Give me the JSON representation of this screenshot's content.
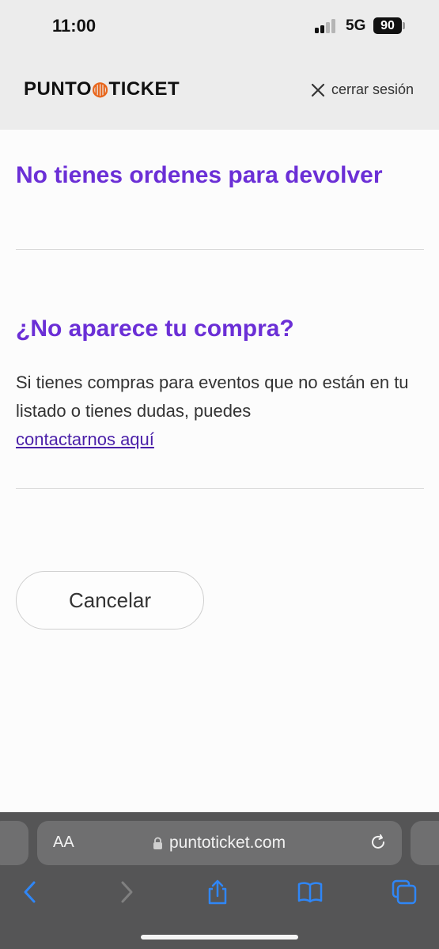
{
  "status_bar": {
    "time": "11:00",
    "network": "5G",
    "battery": "90"
  },
  "header": {
    "logo_text_left": "PUNTO",
    "logo_text_right": "TICKET",
    "logout_label": "cerrar sesión",
    "logo_icon": "flame-icon",
    "logout_icon": "close-icon"
  },
  "main": {
    "no_orders_title": "No tienes ordenes para devolver",
    "missing_title": "¿No aparece tu compra?",
    "missing_text": "Si tienes compras para eventos que no están en tu listado o tienes dudas, puedes",
    "contact_link": "contactarnos aquí",
    "cancel_button": "Cancelar"
  },
  "browser": {
    "text_size_label": "AA",
    "url": "puntoticket.com",
    "icons": [
      "lock-icon",
      "reload-icon",
      "back-icon",
      "forward-icon",
      "share-icon",
      "bookmarks-icon",
      "tabs-icon"
    ]
  },
  "colors": {
    "accent": "#6b2fd6",
    "link": "#4a1fa8",
    "header_bg": "#ececec",
    "brand_orange": "#e8661c"
  }
}
